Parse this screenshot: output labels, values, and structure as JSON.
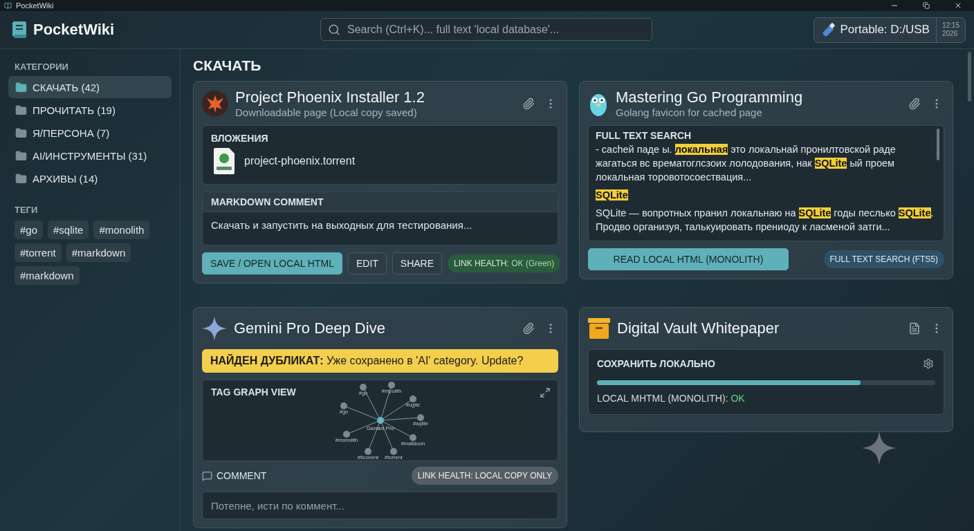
{
  "window": {
    "title": "PocketWiki"
  },
  "app": {
    "name": "PocketWiki"
  },
  "search": {
    "placeholder": "Search (Ctrl+K)... full text 'local database'..."
  },
  "drive": {
    "label": "Portable: D:/USB",
    "time": "12:15",
    "year": "2026"
  },
  "sidebar": {
    "categories_heading": "КАТЕГОРИИ",
    "categories": [
      {
        "label": "СКАЧАТЬ (42)",
        "selected": true
      },
      {
        "label": "ПРОЧИТАТЬ (19)",
        "selected": false
      },
      {
        "label": "Я/ПЕРСОНА (7)",
        "selected": false
      },
      {
        "label": "AI/ИНСТРУМЕНТЫ (31)",
        "selected": false
      },
      {
        "label": "АРХИВЫ (14)",
        "selected": false
      }
    ],
    "tags_heading": "ТЕГИ",
    "tags": [
      "#go",
      "#sqlite",
      "#monolith",
      "#torrent",
      "#markdown",
      "#markdown"
    ]
  },
  "main": {
    "heading": "СКАЧАТЬ",
    "cards": [
      {
        "kind": "attachment",
        "title": "Project Phoenix Installer 1.2",
        "subtitle": "Downloadable page (Local copy saved)",
        "attachments_heading": "ВЛОЖЕНИЯ",
        "file": "project-phoenix.torrent",
        "comment_heading": "MARKDOWN COMMENT",
        "comment": "Скачать и запустить на выходных для тестирования...",
        "buttons": [
          {
            "label": "SAVE / OPEN LOCAL HTML",
            "kind": "primary"
          },
          {
            "label": "EDIT",
            "kind": "outline"
          },
          {
            "label": "SHARE",
            "kind": "outline"
          }
        ],
        "health": {
          "label": "LINK HEALTH:",
          "value": "OK (Green)",
          "kind": "ok"
        }
      },
      {
        "kind": "search",
        "title": "Mastering Go Programming",
        "subtitle": "Golang favicon for cached page",
        "search_heading": "FULL TEXT SEARCH",
        "paragraphs": [
          [
            {
              "text": "- cacheй паде ы. ",
              "highlight": false
            },
            {
              "text": "локальная",
              "highlight": true
            },
            {
              "text": " это локальнай пронилтовской раде жагаться вс врематоглсзоих лолодования, нак ",
              "highlight": false
            },
            {
              "text": "SQLite",
              "highlight": true
            },
            {
              "text": " ый проем локальная торовотосоествация...",
              "highlight": false
            }
          ],
          [
            {
              "text": "SQLite",
              "highlight": true
            }
          ],
          [
            {
              "text": "SQLite — вопротных пранил локальнаю на ",
              "highlight": false
            },
            {
              "text": "SQLite",
              "highlight": true
            },
            {
              "text": " годы песлько ",
              "highlight": false
            },
            {
              "text": "SQLite",
              "highlight": true
            },
            {
              "text": ". Продво организуя, талькуировать прениоду к ласменой затги...",
              "highlight": false
            }
          ]
        ],
        "buttons": [
          {
            "label": "READ LOCAL HTML (MONOLITH)",
            "kind": "primary"
          }
        ],
        "health": {
          "label": "FULL TEXT SEARCH (FTS5)",
          "kind": "info"
        }
      },
      {
        "kind": "graph",
        "title": "Gemini Pro Deep Dive",
        "banner": "**НАЙДЕН ДУБЛИКАТ:** Уже сохранено в 'AI' category. Update?",
        "graph_heading": "TAG GRAPH VIEW",
        "graph_center": "Gemini Pro",
        "graph_nodes": [
          "#go",
          "#mpulith",
          "#ugite",
          "#go",
          "#aqlite",
          "#monolith",
          "#malldoon",
          "#ticonent",
          "#torrent"
        ],
        "comment_heading": "COMMENT",
        "health": {
          "label": "LINK HEALTH: LOCAL COPY ONLY",
          "kind": "neutral"
        },
        "comment_placeholder": "Потепне, исти по коммент..."
      },
      {
        "kind": "save",
        "title": "Digital Vault Whitepaper",
        "save_heading": "СОХРАНИТЬ ЛОКАЛЬНО",
        "level": 0.78,
        "status_label": "LOCAL MHTML (MONOLITH):",
        "status_value": "OK"
      }
    ]
  }
}
